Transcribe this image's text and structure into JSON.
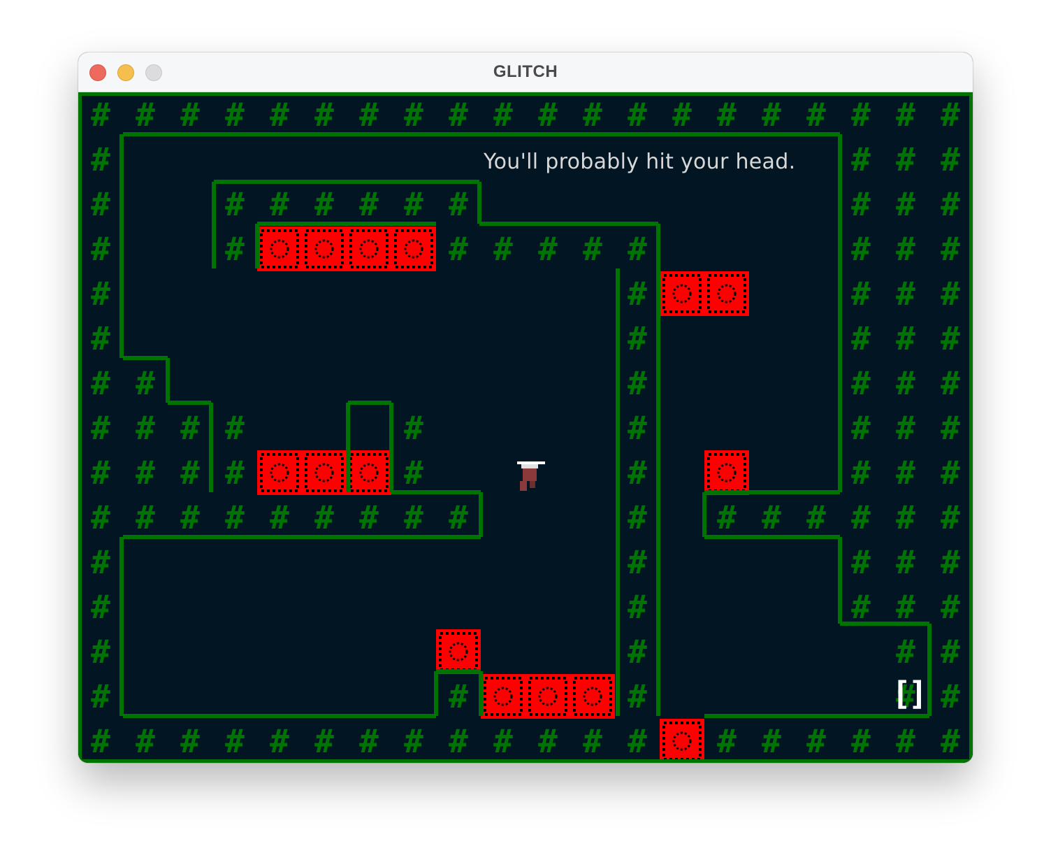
{
  "window": {
    "title": "GLITCH"
  },
  "game": {
    "message": "You'll probably hit your head.",
    "exit_glyph": "[]",
    "wall_glyph": "#",
    "colors": {
      "background": "#021523",
      "wall": "#007400",
      "hazard": "#ff0000",
      "hazard_core": "#000000",
      "text": "#d8d8d8",
      "exit": "#ffffff"
    },
    "map": [
      "####################",
      "#...............###",
      "#...######......###",
      "#...#XXXX#####..###",
      "#.........#.XX..###",
      "#.........#.....###",
      "##........#.....###",
      "###...#...#.....###",
      "###XXX#...#.X...###",
      "##########..####",
      "#.........#.....###",
      "#.........#.....###",
      "#.......X.#.......#",
      "#.......#XXX#.....#",
      "###############X######"
    ]
  }
}
